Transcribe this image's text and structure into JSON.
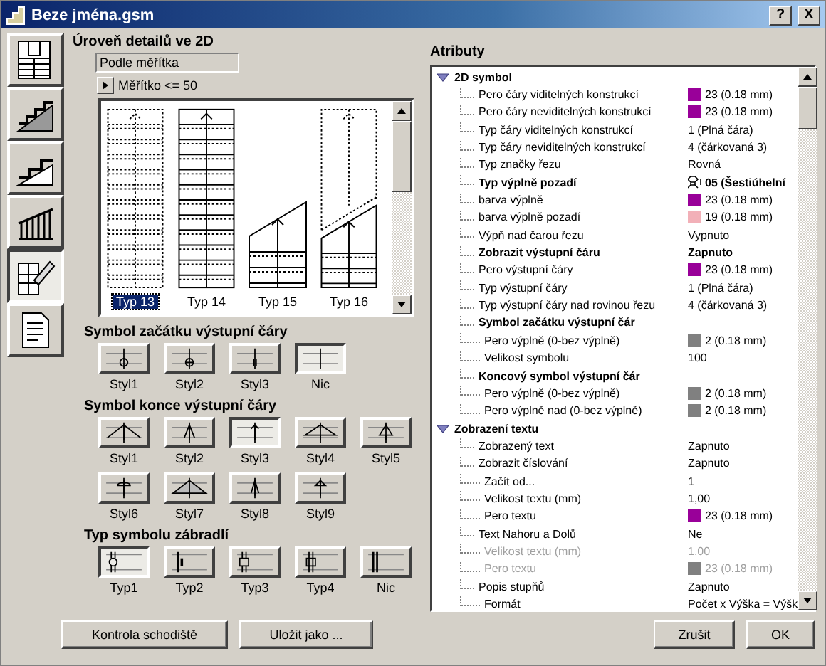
{
  "window": {
    "title": "Beze jména.gsm",
    "help_button": "?",
    "close_button": "X"
  },
  "tabs": [
    {
      "selected": false
    },
    {
      "selected": false
    },
    {
      "selected": false
    },
    {
      "selected": false
    },
    {
      "selected": true
    },
    {
      "selected": false
    }
  ],
  "detail": {
    "heading": "Úroveň detailů ve 2D",
    "mode": "Podle měřítka",
    "scale": "Měřítko <= 50"
  },
  "previews": [
    {
      "label": "Typ 13",
      "selected": true,
      "kind": "dotted"
    },
    {
      "label": "Typ 14",
      "selected": false,
      "kind": "solid"
    },
    {
      "label": "Typ 15",
      "selected": false,
      "kind": "cut"
    },
    {
      "label": "Typ 16",
      "selected": false,
      "kind": "cut-dotted"
    }
  ],
  "start_symbols": {
    "heading": "Symbol začátku výstupní čáry",
    "items": [
      {
        "label": "Styl1",
        "selected": false
      },
      {
        "label": "Styl2",
        "selected": false
      },
      {
        "label": "Styl3",
        "selected": false
      },
      {
        "label": "Nic",
        "selected": true
      }
    ]
  },
  "end_symbols": {
    "heading": "Symbol konce výstupní čáry",
    "items": [
      {
        "label": "Styl1",
        "selected": false
      },
      {
        "label": "Styl2",
        "selected": false
      },
      {
        "label": "Styl3",
        "selected": true
      },
      {
        "label": "Styl4",
        "selected": false
      },
      {
        "label": "Styl5",
        "selected": false
      },
      {
        "label": "Styl6",
        "selected": false
      },
      {
        "label": "Styl7",
        "selected": false
      },
      {
        "label": "Styl8",
        "selected": false
      },
      {
        "label": "Styl9",
        "selected": false
      }
    ]
  },
  "railing_symbols": {
    "heading": "Typ symbolu zábradlí",
    "items": [
      {
        "label": "Typ1",
        "selected": true
      },
      {
        "label": "Typ2",
        "selected": false
      },
      {
        "label": "Typ3",
        "selected": false
      },
      {
        "label": "Typ4",
        "selected": false
      },
      {
        "label": "Nic",
        "selected": false
      }
    ]
  },
  "buttons": [
    "Kontrola schodiště",
    "Uložit jako ..."
  ],
  "attributes": {
    "heading": "Atributy",
    "tree": [
      {
        "kind": "section",
        "label": "2D symbol",
        "expanded": true,
        "children": [
          {
            "kind": "plain",
            "label": "Pero čáry viditelných konstrukcí",
            "value": "23 (0.18 mm)",
            "color": "#990099",
            "disabled": false
          },
          {
            "kind": "plain",
            "label": "Pero čáry neviditelných konstrukcí",
            "value": "23 (0.18 mm)",
            "color": "#990099",
            "disabled": false
          },
          {
            "kind": "plain",
            "label": "Typ čáry viditelných konstrukcí",
            "value": "1 (Plná čára)",
            "disabled": false
          },
          {
            "kind": "plain",
            "label": "Typ čáry neviditelných konstrukcí",
            "value": "4 (čárkovaná 3)",
            "disabled": false
          },
          {
            "kind": "plain",
            "label": "Typ značky řezu",
            "value": "Rovná",
            "disabled": false
          },
          {
            "kind": "bold",
            "label": "Typ výplně pozadí",
            "value": "05 (Šestiúhelní",
            "pattern": true,
            "disabled": false
          },
          {
            "kind": "plain",
            "label": "barva výplně",
            "value": "23 (0.18 mm)",
            "color": "#990099",
            "disabled": false
          },
          {
            "kind": "plain",
            "label": "barva výplně pozadí",
            "value": "19 (0.18 mm)",
            "color": "#f2b0b8",
            "disabled": false
          },
          {
            "kind": "plain",
            "label": "Výpň nad čarou řezu",
            "value": "Vypnuto",
            "disabled": false
          },
          {
            "kind": "bold",
            "label": "Zobrazit výstupní čáru",
            "value": "Zapnuto",
            "disabled": false
          },
          {
            "kind": "plain",
            "label": "Pero výstupní čáry",
            "value": "23 (0.18 mm)",
            "color": "#990099",
            "disabled": false
          },
          {
            "kind": "plain",
            "label": "Typ výstupní čáry",
            "value": "1 (Plná čára)",
            "disabled": false
          },
          {
            "kind": "plain",
            "label": "Typ výstupní čáry nad rovinou řezu",
            "value": "4 (čárkovaná 3)",
            "disabled": false
          },
          {
            "kind": "bold",
            "label": "Symbol začátku výstupní čár",
            "disabled": false,
            "children": [
              {
                "kind": "plain",
                "label": "Pero výplně (0-bez výplně)",
                "value": "2 (0.18 mm)",
                "color": "#808080",
                "disabled": false
              },
              {
                "kind": "plain",
                "label": "Velikost symbolu",
                "value": "100",
                "disabled": false
              }
            ]
          },
          {
            "kind": "bold",
            "label": "Koncový symbol výstupní čár",
            "disabled": false,
            "children": [
              {
                "kind": "plain",
                "label": "Pero výplně (0-bez výplně)",
                "value": "2 (0.18 mm)",
                "color": "#808080",
                "disabled": false
              },
              {
                "kind": "plain",
                "label": "Pero výplně nad (0-bez výplně)",
                "value": "2 (0.18 mm)",
                "color": "#808080",
                "disabled": false
              }
            ]
          }
        ]
      },
      {
        "kind": "section",
        "label": "Zobrazení textu",
        "expanded": true,
        "children": [
          {
            "kind": "plain",
            "label": "Zobrazený text",
            "value": "Zapnuto",
            "disabled": false
          },
          {
            "kind": "plain",
            "label": "Zobrazit číslování",
            "value": "Zapnuto",
            "disabled": false,
            "children": [
              {
                "kind": "plain",
                "label": "Začít od...",
                "value": "1",
                "disabled": false
              },
              {
                "kind": "plain",
                "label": "Velikost textu (mm)",
                "value": "1,00",
                "disabled": false
              },
              {
                "kind": "plain",
                "label": "Pero textu",
                "value": "23 (0.18 mm)",
                "color": "#990099",
                "disabled": false
              }
            ]
          },
          {
            "kind": "plain",
            "label": "Text Nahoru a Dolů",
            "value": "Ne",
            "disabled": false,
            "children": [
              {
                "kind": "plain",
                "label": "Velikost textu (mm)",
                "value": "1,00",
                "disabled": true
              },
              {
                "kind": "plain",
                "label": "Pero textu",
                "value": "23 (0.18 mm)",
                "color": "#808080",
                "disabled": true
              }
            ]
          },
          {
            "kind": "plain",
            "label": "Popis stupňů",
            "value": "Zapnuto",
            "disabled": false,
            "children": [
              {
                "kind": "plain",
                "label": "Formát",
                "value": "Počet x Výška = Výšk",
                "disabled": false
              }
            ]
          }
        ]
      }
    ]
  },
  "dialog_buttons": [
    "Zrušit",
    "OK"
  ]
}
